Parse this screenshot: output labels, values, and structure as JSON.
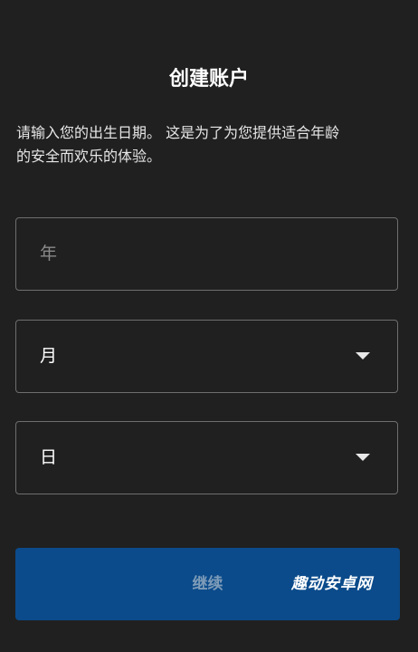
{
  "page": {
    "title": "创建账户",
    "description": "请输入您的出生日期。 这是为了为您提供适合年龄\n的安全而欢乐的体验。"
  },
  "form": {
    "year": {
      "placeholder": "年",
      "value": ""
    },
    "month": {
      "value": "月",
      "icon": "chevron-down-icon"
    },
    "day": {
      "value": "日",
      "icon": "chevron-down-icon"
    }
  },
  "actions": {
    "continue_label": "继续",
    "continue_enabled": false
  },
  "watermark": "趣动安卓网",
  "colors": {
    "background": "#202020",
    "field_border": "#6e6e6e",
    "button": "#0b4b8b",
    "button_label_disabled": "#7f9cb8"
  }
}
